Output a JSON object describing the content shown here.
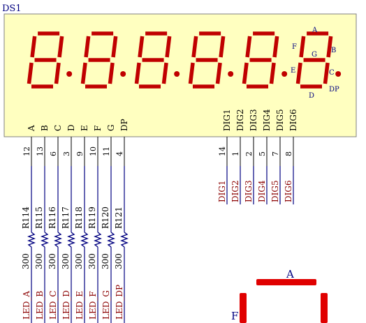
{
  "component": {
    "designator": "DS1",
    "digit_count": 6,
    "segment_pins": [
      {
        "label": "A",
        "pin": "12"
      },
      {
        "label": "B",
        "pin": "13"
      },
      {
        "label": "C",
        "pin": "6"
      },
      {
        "label": "D",
        "pin": "3"
      },
      {
        "label": "E",
        "pin": "9"
      },
      {
        "label": "F",
        "pin": "10"
      },
      {
        "label": "G",
        "pin": "11"
      },
      {
        "label": "DP",
        "pin": "4"
      }
    ],
    "digit_pins": [
      {
        "label": "DIG1",
        "pin": "14"
      },
      {
        "label": "DIG2",
        "pin": "1"
      },
      {
        "label": "DIG3",
        "pin": "2"
      },
      {
        "label": "DIG4",
        "pin": "5"
      },
      {
        "label": "DIG5",
        "pin": "7"
      },
      {
        "label": "DIG6",
        "pin": "8"
      }
    ],
    "segment_legend": {
      "A": "A",
      "B": "B",
      "C": "C",
      "D": "D",
      "E": "E",
      "F": "F",
      "G": "G",
      "DP": "DP"
    }
  },
  "resistors": [
    {
      "ref": "R114",
      "value": "300",
      "net": "LED_A"
    },
    {
      "ref": "R115",
      "value": "300",
      "net": "LED_B"
    },
    {
      "ref": "R116",
      "value": "300",
      "net": "LED_C"
    },
    {
      "ref": "R117",
      "value": "300",
      "net": "LED_D"
    },
    {
      "ref": "R118",
      "value": "300",
      "net": "LED_E"
    },
    {
      "ref": "R119",
      "value": "300",
      "net": "LED_F"
    },
    {
      "ref": "R120",
      "value": "300",
      "net": "LED_G"
    },
    {
      "ref": "R121",
      "value": "300",
      "net": "LED_DP"
    }
  ],
  "digit_nets": [
    "DIG1",
    "DIG2",
    "DIG3",
    "DIG4",
    "DIG5",
    "DIG6"
  ],
  "detail_view": {
    "label_a": "A",
    "label_f": "F"
  },
  "colors": {
    "body_fill": "#ffffc0",
    "body_stroke": "#808080",
    "segment": "#c00000",
    "segment_bright": "#e00000",
    "wire": "#000080",
    "net_label": "#8b0000",
    "pin_text": "#000000",
    "legend_text": "#000080"
  }
}
